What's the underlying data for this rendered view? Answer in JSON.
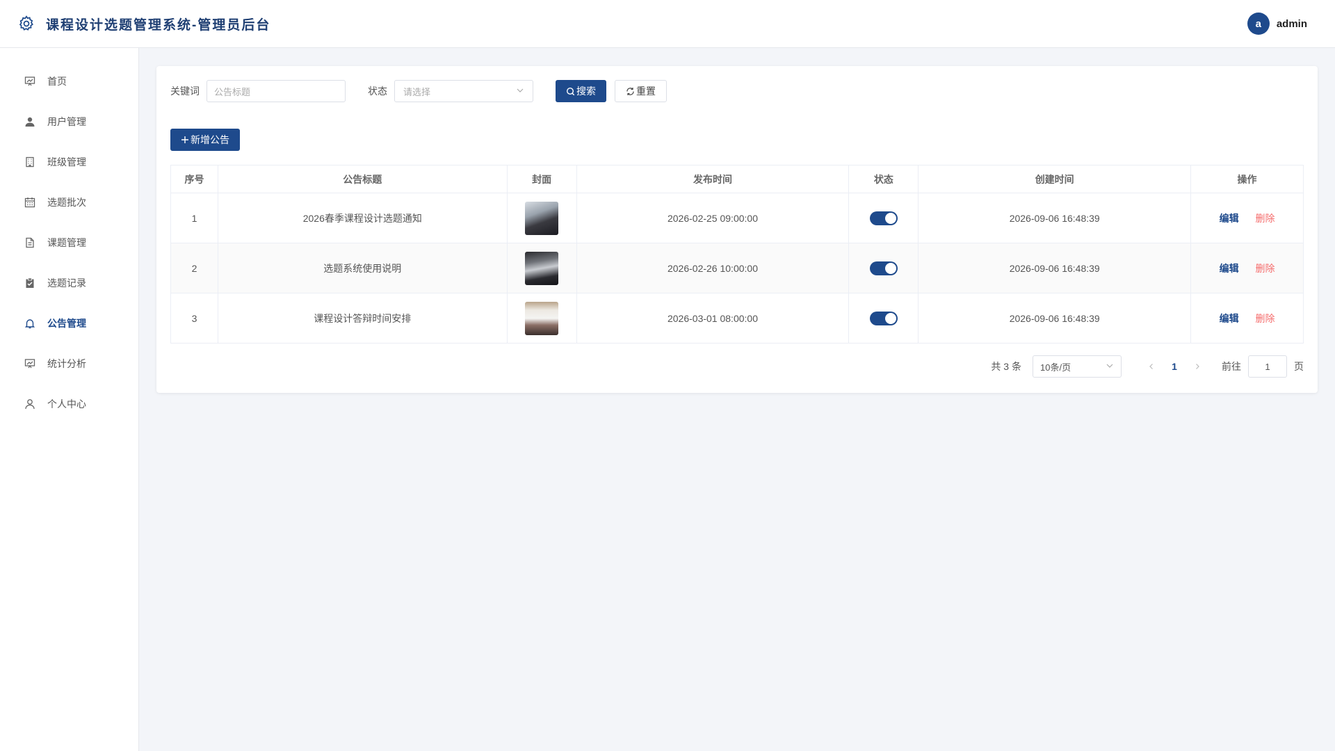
{
  "header": {
    "title": "课程设计选题管理系统-管理员后台",
    "avatar_letter": "a",
    "username": "admin"
  },
  "sidebar": {
    "items": [
      {
        "label": "首页",
        "icon": "chart-board-icon"
      },
      {
        "label": "用户管理",
        "icon": "user-icon"
      },
      {
        "label": "班级管理",
        "icon": "building-icon"
      },
      {
        "label": "选题批次",
        "icon": "calendar-icon"
      },
      {
        "label": "课题管理",
        "icon": "document-icon"
      },
      {
        "label": "选题记录",
        "icon": "clipboard-check-icon"
      },
      {
        "label": "公告管理",
        "icon": "bell-icon",
        "active": true
      },
      {
        "label": "统计分析",
        "icon": "chart-board-icon"
      },
      {
        "label": "个人中心",
        "icon": "person-outline-icon"
      }
    ]
  },
  "filter": {
    "keyword_label": "关键词",
    "keyword_placeholder": "公告标题",
    "status_label": "状态",
    "status_placeholder": "请选择",
    "search_label": "搜索",
    "reset_label": "重置"
  },
  "add_label": "新增公告",
  "table": {
    "headers": [
      "序号",
      "公告标题",
      "封面",
      "发布时间",
      "状态",
      "创建时间",
      "操作"
    ],
    "rows": [
      {
        "index": "1",
        "title": "2026春季课程设计选题通知",
        "publish": "2026-02-25 09:00:00",
        "enabled": true,
        "created": "2026-09-06 16:48:39"
      },
      {
        "index": "2",
        "title": "选题系统使用说明",
        "publish": "2026-02-26 10:00:00",
        "enabled": true,
        "created": "2026-09-06 16:48:39"
      },
      {
        "index": "3",
        "title": "课程设计答辩时间安排",
        "publish": "2026-03-01 08:00:00",
        "enabled": true,
        "created": "2026-09-06 16:48:39"
      }
    ],
    "edit_label": "编辑",
    "delete_label": "删除"
  },
  "pagination": {
    "total": "共 3 条",
    "page_size": "10条/页",
    "current": "1",
    "goto_label": "前往",
    "goto_value": "1",
    "page_suffix": "页"
  },
  "colors": {
    "primary": "#1e4a8c",
    "danger": "#f56c6c",
    "background": "#f3f5f9"
  }
}
